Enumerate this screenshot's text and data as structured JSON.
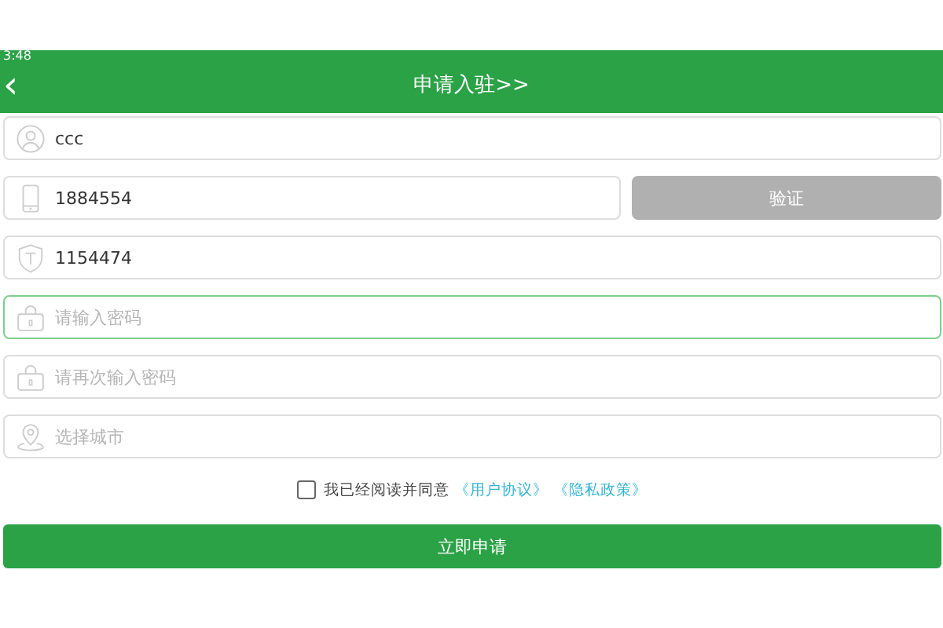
{
  "status_bar": {
    "time": "3:48"
  },
  "header": {
    "back": "‹",
    "title": "申请入驻>>"
  },
  "fields": [
    {
      "value": "ccc",
      "focused": false
    },
    {
      "value": "1884554",
      "focused": false,
      "button": {
        "label": "验证",
        "disabled": true
      }
    },
    {
      "value": "1154474",
      "focused": false
    },
    {
      "placeholder": "请输入密码",
      "focused": true
    },
    {
      "placeholder": "请再次输入密码",
      "focused": false
    },
    {
      "placeholder": "选择城市",
      "focused": false
    }
  ],
  "agreement": {
    "checked": false,
    "text": "我已经阅读并同意",
    "links": [
      "《用户协议》",
      "《隐私政策》"
    ]
  },
  "submit": {
    "label": "立即申请"
  }
}
